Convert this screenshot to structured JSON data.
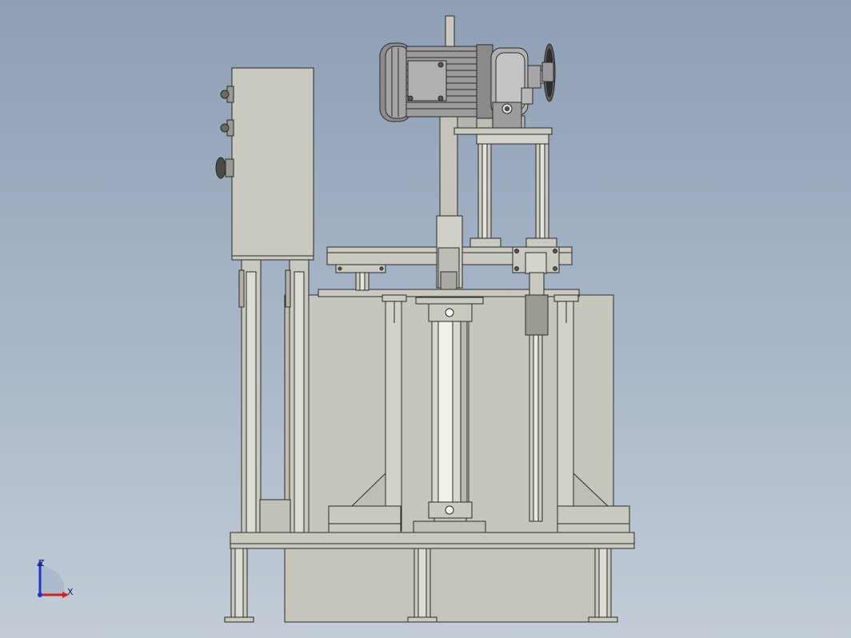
{
  "viewport": {
    "background_top": "#8e9fb5",
    "background_bottom": "#c3ccd6"
  },
  "model": {
    "part_color": "#c9c9c0",
    "shade_color": "#a8a8a0",
    "edge_color": "#2a2a2a",
    "motor_color": "#8a8a8a",
    "components": [
      "control-box",
      "motor",
      "gearbox",
      "sprocket",
      "lift-cylinder",
      "guide-rods",
      "base-frame",
      "hopper-tank"
    ]
  },
  "triad": {
    "z_label": "Z",
    "x_label": "X",
    "z_color": "#2233cc",
    "x_color": "#cc2222"
  }
}
